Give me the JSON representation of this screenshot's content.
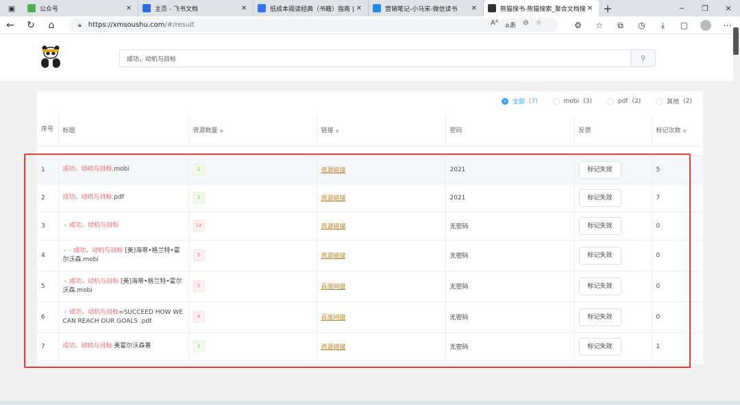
{
  "browser": {
    "tabs": [
      {
        "title": "公众号",
        "color": "#4caf50"
      },
      {
        "title": "主页 - 飞书文档",
        "color": "#2b6de5"
      },
      {
        "title": "低成本阅读经典（书籍）指南 | 飞",
        "color": "#3370ff"
      },
      {
        "title": "营销笔记-小马宋-微信读书",
        "color": "#1e88e5"
      },
      {
        "title": "熊猫搜书-熊猫搜索_聚合文档搜索",
        "color": "#333333"
      }
    ],
    "new_tab": "+",
    "url_host": "https://xmsoushu.com",
    "url_path": "/#/result"
  },
  "search": {
    "query": "成功，动机与目标"
  },
  "filters": [
    {
      "label": "全部",
      "count": "(7)",
      "selected": true
    },
    {
      "label": "mobi",
      "count": "(3)",
      "selected": false
    },
    {
      "label": "pdf",
      "count": "(2)",
      "selected": false
    },
    {
      "label": "其他",
      "count": "(2)",
      "selected": false
    }
  ],
  "table": {
    "headers": {
      "index": "序号",
      "title": "标题",
      "resources": "资源数量",
      "link": "链接",
      "password": "密码",
      "feedback": "反馈",
      "marks": "标记次数"
    },
    "rows": [
      {
        "index": "1",
        "prefix": "",
        "hl": "成功，动机与目标",
        "rest": ".mobi",
        "count": "1",
        "count_type": "g",
        "link": "资源链接",
        "password": "2021",
        "button": "标记失效",
        "marks": "5"
      },
      {
        "index": "2",
        "prefix": "",
        "hl": "成功，动机与目标",
        "rest": ".pdf",
        "count": "1",
        "count_type": "g",
        "link": "资源链接",
        "password": "2021",
        "button": "标记失效",
        "marks": "7"
      },
      {
        "index": "3",
        "prefix": "›",
        "hl": "成功，动机与目标",
        "rest": "",
        "count": "14",
        "count_type": "r",
        "link": "资源链接",
        "password": "无密码",
        "button": "标记失效",
        "marks": "0"
      },
      {
        "index": "4",
        "prefix": "› -",
        "hl": "成功，动机与目标",
        "rest": " [美]海蒂•格兰特•霍尔沃森.mobi",
        "count": "5",
        "count_type": "r",
        "link": "资源链接",
        "password": "无密码",
        "button": "标记失效",
        "marks": "0"
      },
      {
        "index": "5",
        "prefix": "›",
        "hl": "成功，动机与目标",
        "rest": " [美]海蒂•格兰特•霍尔沃森.mobi",
        "count": "5",
        "count_type": "r",
        "link": "百度网盘",
        "password": "无密码",
        "button": "标记失效",
        "marks": "0"
      },
      {
        "index": "6",
        "prefix": "›",
        "hl": "成功，动机与目标",
        "rest": "=SUCCEED HOW WE CAN REACH OUR GOALS .pdf",
        "count": "4",
        "count_type": "r",
        "link": "百度网盘",
        "password": "无密码",
        "button": "标记失效",
        "marks": "0"
      },
      {
        "index": "7",
        "prefix": "",
        "hl": "成功，动机与目标",
        "rest": " 美霍尔沃森著",
        "count": "1",
        "count_type": "g",
        "link": "资源链接",
        "password": "无密码",
        "button": "标记失效",
        "marks": "1"
      }
    ]
  }
}
